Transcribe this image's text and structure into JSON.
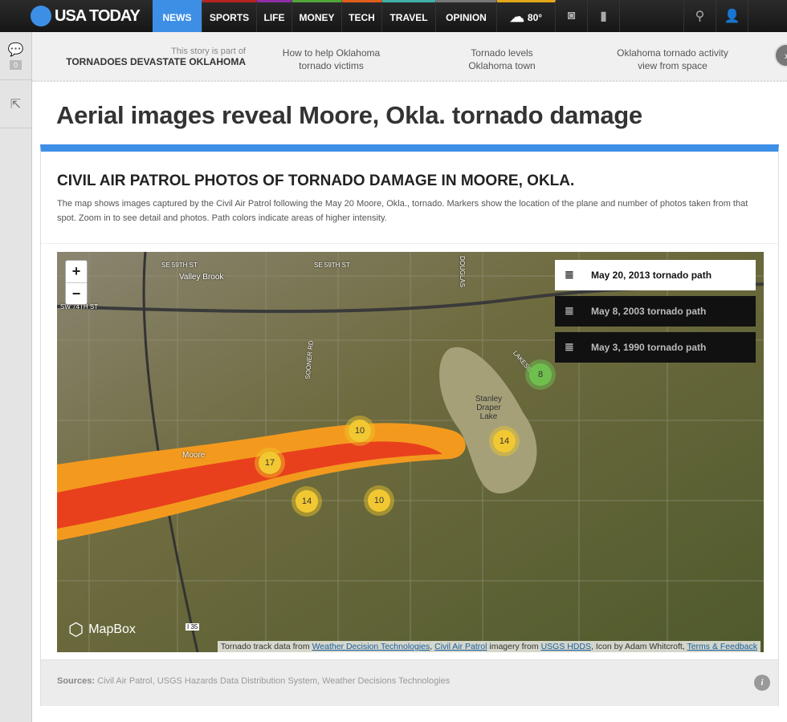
{
  "brand": {
    "name": "USA TODAY",
    "color": "#3d8fe6"
  },
  "nav": [
    {
      "label": "NEWS",
      "color": "#3d8fe6"
    },
    {
      "label": "SPORTS",
      "color": "#b8231e"
    },
    {
      "label": "LIFE",
      "color": "#8e2ea6"
    },
    {
      "label": "MONEY",
      "color": "#4fa63a"
    },
    {
      "label": "TECH",
      "color": "#e25d1b"
    },
    {
      "label": "TRAVEL",
      "color": "#3fb1a8"
    },
    {
      "label": "OPINION",
      "color": "#777777"
    }
  ],
  "weather": {
    "temp": "80°",
    "icon": "cloud-icon"
  },
  "rail": {
    "comments_count": "0"
  },
  "story": {
    "part_of": "This story is part of",
    "series": "TORNADOES DEVASTATE OKLAHOMA",
    "related": [
      "How to help Oklahoma tornado victims",
      "Tornado levels Oklahoma town",
      "Oklahoma tornado activity view from space"
    ]
  },
  "headline": "Aerial images reveal Moore, Okla. tornado damage",
  "card": {
    "title": "CIVIL AIR PATROL PHOTOS OF TORNADO DAMAGE IN MOORE, OKLA.",
    "description": "The map shows images captured by the Civil Air Patrol following the May 20 Moore, Okla., tornado. Markers show the location of the plane and number of photos taken from that spot. Zoom in to see detail and photos. Path colors indicate areas of higher intensity."
  },
  "map": {
    "zoom_in": "+",
    "zoom_out": "−",
    "legend": [
      {
        "label": "May 20, 2013 tornado path",
        "selected": true
      },
      {
        "label": "May 8, 2003 tornado path",
        "selected": false
      },
      {
        "label": "May 3, 1990 tornado path",
        "selected": false
      }
    ],
    "markers": [
      {
        "count": "17"
      },
      {
        "count": "10"
      },
      {
        "count": "14"
      },
      {
        "count": "10"
      },
      {
        "count": "14"
      },
      {
        "count": "8"
      }
    ],
    "labels": [
      "SE 59TH ST",
      "SE 59TH ST",
      "Valley Brook",
      "SW 74TH ST",
      "Moore",
      "Stanley Draper Lake",
      "SOONER RD",
      "DOUGLAS",
      "LAKESIDE DR",
      "I 35"
    ],
    "path_colors": {
      "outer": "#f39a1e",
      "inner": "#e8401c"
    },
    "logo": "MapBox",
    "attribution": {
      "t1": "Tornado track data from ",
      "l1": "Weather Decision Technologies",
      "t2": ", ",
      "l2": "Civil Air Patrol",
      "t3": " imagery from ",
      "l3": "USGS HDDS",
      "t4": ", Icon by Adam Whitcroft, ",
      "l4": "Terms & Feedback"
    }
  },
  "sources": {
    "label": "Sources:",
    "text": " Civil Air Patrol, USGS Hazards Data Distribution System, Weather Decisions Technologies"
  }
}
